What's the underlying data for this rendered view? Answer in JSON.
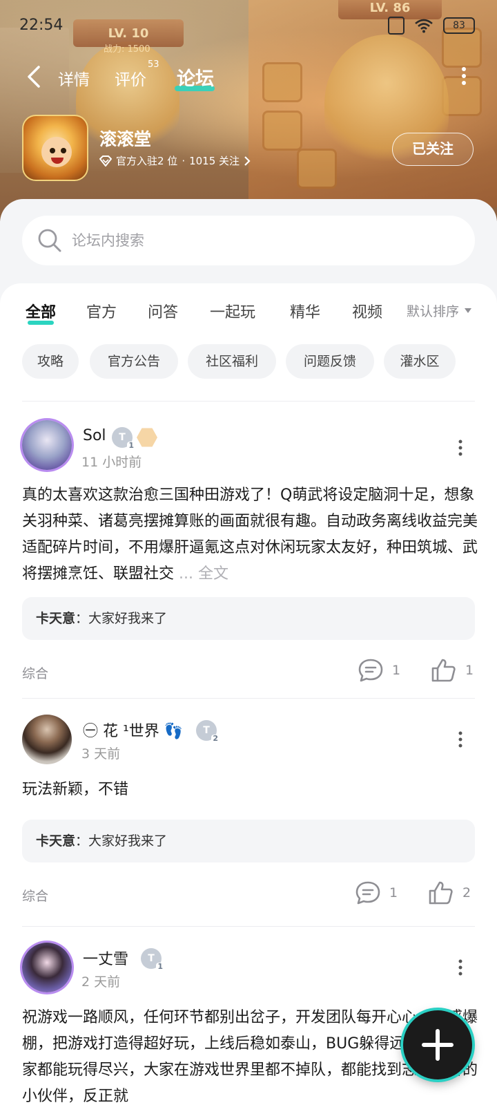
{
  "status_bar": {
    "time": "22:54",
    "battery": "83"
  },
  "banner_art": {
    "lv_left": "LV. 10",
    "power_left": "战力: 1500",
    "lv_right": "LV. 86"
  },
  "nav": {
    "tabs": [
      {
        "label": "详情"
      },
      {
        "label": "评价",
        "badge": "53"
      },
      {
        "label": "论坛",
        "active": true
      }
    ]
  },
  "app": {
    "name": "滚滚堂",
    "meta_official": "官方入驻2 位",
    "meta_followers": "1015 关注",
    "follow_label": "已关注"
  },
  "search": {
    "placeholder": "论坛内搜索"
  },
  "category_tabs": [
    {
      "label": "全部",
      "active": true
    },
    {
      "label": "官方"
    },
    {
      "label": "问答"
    },
    {
      "label": "一起玩"
    },
    {
      "label": "精华"
    },
    {
      "label": "视频"
    }
  ],
  "sort_label": "默认排序",
  "chips": [
    "攻略",
    "官方公告",
    "社区福利",
    "问题反馈",
    "灌水区"
  ],
  "posts": [
    {
      "username": "Sol",
      "badge_level": "1",
      "time": "11 小时前",
      "body": "真的太喜欢这款治愈三国种田游戏了！Q萌武将设定脑洞十足，想象关羽种菜、诸葛亮摆摊算账的画面就很有趣。自动政务离线收益完美适配碎片时间，不用爆肝逼氪这点对休闲玩家太友好，种田筑城、武将摆摊烹饪、联盟社交",
      "fulltext": "... 全文",
      "reply_user": "卡天意",
      "reply_text": "大家好我来了",
      "tag": "综合",
      "comments": "1",
      "likes": "1"
    },
    {
      "username": "㊀ 花 ¹世界 👣",
      "badge_level": "2",
      "time": "3 天前",
      "body": "玩法新颖，不错",
      "reply_user": "卡天意",
      "reply_text": "大家好我来了",
      "tag": "综合",
      "comments": "1",
      "likes": "2"
    },
    {
      "username": "一丈雪",
      "badge_level": "1",
      "time": "2 天前",
      "body": "祝游戏一路顺风，任何环节都别出岔子，开发团队每开心心，灵感爆棚，把游戏打造得超好玩，上线后稳如泰山，BUG躲得远远的。玩家都能玩得尽兴，大家在游戏世界里都不掉队，都能找到志同道合的小伙伴，反正就"
    }
  ],
  "colors": {
    "accent": "#2bd4c0",
    "fab_bg": "#1b1b1b"
  }
}
